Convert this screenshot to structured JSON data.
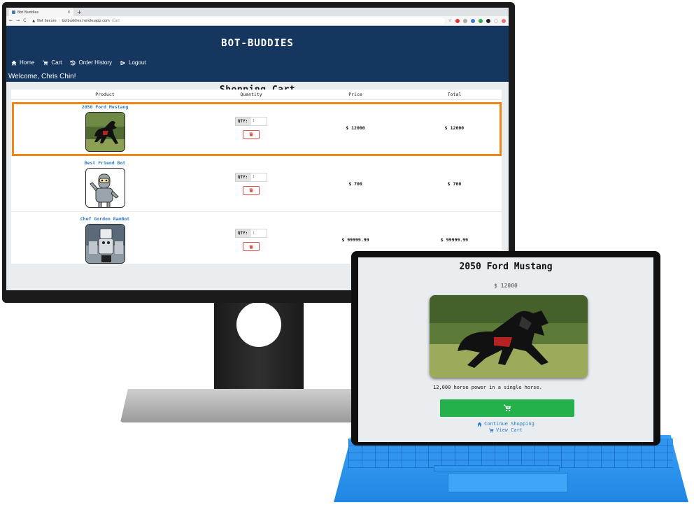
{
  "browser": {
    "tab_title": "Bot Buddies",
    "tab_close": "×",
    "new_tab": "+",
    "security_label": "Not Secure",
    "url_host": "botbuddies.herokuapp.com",
    "url_path": "/cart"
  },
  "site": {
    "brand": "BOT-BUDDIES",
    "nav": [
      {
        "label": "Home",
        "icon": "home-icon"
      },
      {
        "label": "Cart",
        "icon": "cart-icon"
      },
      {
        "label": "Order History",
        "icon": "history-icon"
      },
      {
        "label": "Logout",
        "icon": "logout-icon"
      }
    ],
    "welcome": "Welcome, Chris Chin!"
  },
  "cart": {
    "title": "Shopping Cart",
    "headers": {
      "product": "Product",
      "quantity": "Quantity",
      "price": "Price",
      "total": "Total"
    },
    "qty_label": "QTY:",
    "rows": [
      {
        "name": "2050 Ford Mustang",
        "qty_placeholder": "1",
        "price": "$ 12000",
        "total": "$ 12000"
      },
      {
        "name": "Best Friend Bot",
        "qty_placeholder": "1",
        "price": "$ 700",
        "total": "$ 700"
      },
      {
        "name": "Chef Gordon RamBot",
        "qty_placeholder": "1",
        "price": "$ 99999.99",
        "total": "$ 99999.99"
      }
    ]
  },
  "tablet": {
    "product_title": "2050 Ford Mustang",
    "price": "$ 12000",
    "description": "12,000 horse power in a single horse.",
    "continue_shopping": "Continue Shopping",
    "view_cart": "View Cart"
  },
  "colors": {
    "header_bg": "#14365f",
    "link": "#2a79c7",
    "highlight": "#ee8514",
    "add_to_cart": "#24b04b",
    "delete": "#e0524e",
    "keyboard": "#2f95ef"
  }
}
